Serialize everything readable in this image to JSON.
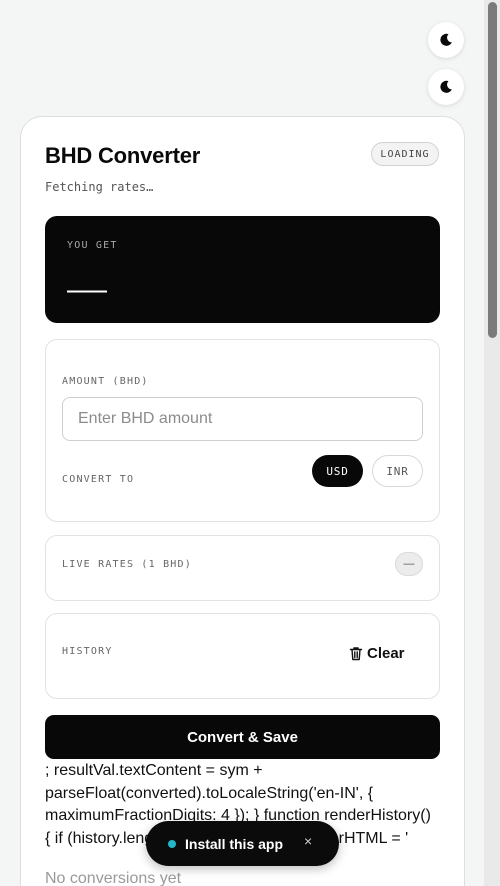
{
  "theme_toggles": [
    {
      "icon": "moon-icon"
    },
    {
      "icon": "moon-icon"
    }
  ],
  "header": {
    "title": "BHD Converter",
    "subtitle": "Fetching rates…",
    "status_badge": "LOADING"
  },
  "result": {
    "label": "YOU GET",
    "value": "——"
  },
  "converter": {
    "amount_label": "AMOUNT (BHD)",
    "amount_value": "",
    "amount_placeholder": "Enter BHD amount",
    "convert_to_label": "CONVERT TO",
    "currencies": [
      {
        "label": "USD",
        "selected": true
      },
      {
        "label": "INR",
        "selected": false
      }
    ]
  },
  "rates": {
    "label": "LIVE RATES (1 BHD)",
    "toggle_label": "—"
  },
  "history": {
    "label": "HISTORY",
    "clear_label": "Clear",
    "clear_icon": "trash-icon",
    "empty_text": "No conversions yet"
  },
  "actions": {
    "convert_label": "Convert & Save"
  },
  "leaked_script_text": "; resultVal.textContent = sym + parseFloat(converted).toLocaleString('en-IN', { maximumFractionDigits: 4 }); } function renderHistory() { if (history.length === 0) { historyList.innerHTML = '",
  "install_banner": {
    "label": "Install this app",
    "close_label": "×"
  },
  "colors": {
    "accent": "#080808",
    "install_dot": "#22b8c9",
    "background": "#f4f5f5"
  }
}
